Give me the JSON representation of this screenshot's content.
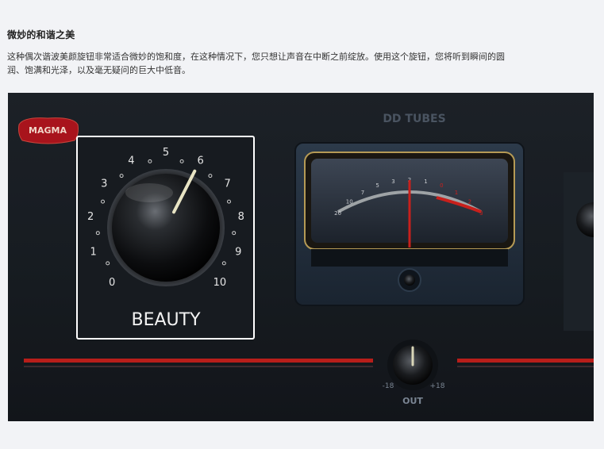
{
  "article": {
    "title": "微妙的和谐之美",
    "description_line1": "这种偶次谐波美颜旋钮非常适合微妙的饱和度，在这种情况下，您只想让声音在中断之前绽放。使用这个旋钮，您将听到瞬间的圆",
    "description_line2": "润、饱满和光泽，以及毫无疑问的巨大中低音。"
  },
  "plugin": {
    "brand": "MAGMA",
    "section_label": "DD TUBES",
    "knob_label": "BEAUTY",
    "knob_scale": [
      "0",
      "1",
      "2",
      "3",
      "4",
      "5",
      "6",
      "7",
      "8",
      "9",
      "10"
    ],
    "knob_value": 6,
    "out_label": "OUT",
    "out_min_label": "-18",
    "out_max_label": "+18",
    "meter_scale": [
      "20",
      "10",
      "7",
      "5",
      "3",
      "2",
      "1",
      "0",
      "1",
      "2",
      "3"
    ]
  },
  "colors": {
    "page_bg": "#f2f3f6",
    "panel_bg": "#1b2026",
    "highlight_border": "#ffffff",
    "accent_red": "#c8201c",
    "brass": "#b59a55",
    "pointer": "#d9d6b8"
  }
}
